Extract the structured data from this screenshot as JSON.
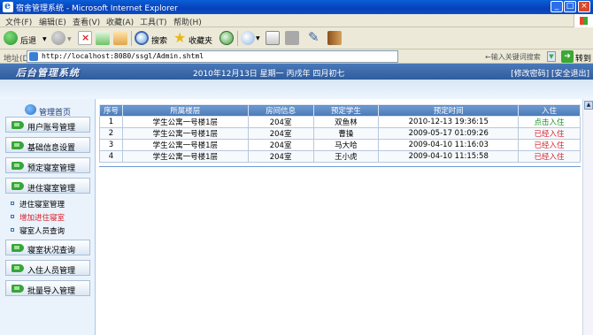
{
  "window": {
    "title": "宿舍管理系统 - Microsoft Internet Explorer",
    "buttons": [
      "_",
      "□",
      "×"
    ]
  },
  "menu": [
    "文件(F)",
    "编辑(E)",
    "查看(V)",
    "收藏(A)",
    "工具(T)",
    "帮助(H)"
  ],
  "toolbar": {
    "back": "后退",
    "search": "搜索",
    "favorites": "收藏夹"
  },
  "address": {
    "label": "地址(D)",
    "url": "http://localhost:8080/ssgl/Admin.shtml",
    "keyword_placeholder": "←输入关键词搜索",
    "go_label": "转到"
  },
  "header": {
    "logo": "后台管理系统",
    "date": "2010年12月13日 星期一 丙戌年 四月初七",
    "links": "[修改密码] [安全退出]"
  },
  "sidebar": {
    "home": "管理首页",
    "buttons_top": [
      "用户账号管理",
      "基础信息设置",
      "预定寝室管理",
      "进住寝室管理"
    ],
    "subitems": [
      {
        "label": "进住寝室管理",
        "active": false
      },
      {
        "label": "增加进住寝室",
        "active": true
      },
      {
        "label": "寝室人员查询",
        "active": false
      }
    ],
    "buttons_bottom": [
      "寝室状况查询",
      "入住人员管理",
      "批量导入管理"
    ]
  },
  "table": {
    "headers": [
      "序号",
      "所属楼层",
      "房间信息",
      "预定学生",
      "预定时间",
      "入住"
    ],
    "rows": [
      [
        "1",
        "学生公寓一号楼1层",
        "204室",
        "双鱼林",
        "2010-12-13 19:36:15",
        "点击入住"
      ],
      [
        "2",
        "学生公寓一号楼1层",
        "204室",
        "曹操",
        "2009-05-17 01:09:26",
        "已经入住"
      ],
      [
        "3",
        "学生公寓一号楼1层",
        "204室",
        "马大哈",
        "2009-04-10 11:16:03",
        "已经入住"
      ],
      [
        "4",
        "学生公寓一号楼1层",
        "204室",
        "王小虎",
        "2009-04-10 11:15:58",
        "已经入住"
      ]
    ]
  },
  "colors": {
    "header_blue": "#3a68aa",
    "action_green": "#1c8f23",
    "action_red": "#d8202a"
  }
}
